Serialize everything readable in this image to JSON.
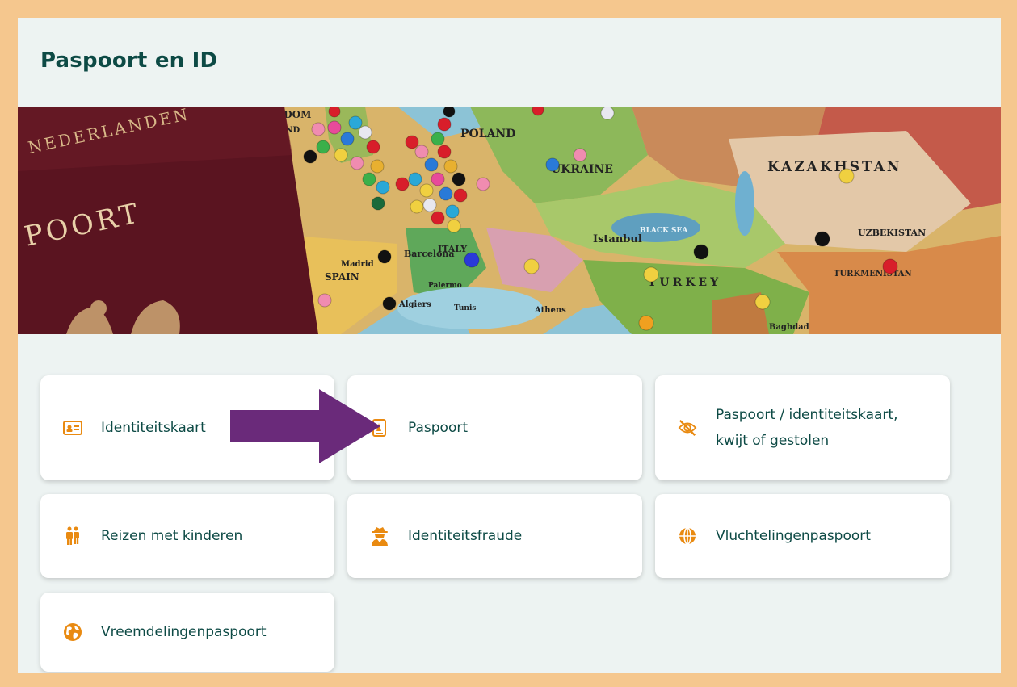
{
  "page": {
    "title": "Paspoort en ID"
  },
  "hero": {
    "passport_text_top": "NEDERLANDEN",
    "passport_text_bottom": "POORT",
    "map_labels": [
      "KINGDOM",
      "IRELAND",
      "POLAND",
      "UKRAINE",
      "KAZAKHSTAN",
      "SPAIN",
      "ITALY",
      "TURKEY",
      "Madrid",
      "Barcelona",
      "Istanbul",
      "Algiers",
      "Athens",
      "Tunis",
      "Palermo",
      "UZBEKISTAN",
      "TURKMENISTAN",
      "Baghdad",
      "BLACK SEA"
    ]
  },
  "tiles": [
    {
      "label": "Identiteitskaart",
      "icon": "id-card-icon"
    },
    {
      "label": "Paspoort",
      "icon": "passport-icon"
    },
    {
      "label_line1": "Paspoort / identiteitskaart,",
      "label_line2": "kwijt of gestolen",
      "icon": "eye-slash-icon"
    },
    {
      "label": "Reizen met kinderen",
      "icon": "child-icon"
    },
    {
      "label": "Identiteitsfraude",
      "icon": "user-secret-icon"
    },
    {
      "label": "Vluchtelingenpaspoort",
      "icon": "globe-icon"
    },
    {
      "label": "Vreemdelingenpaspoort",
      "icon": "earth-icon"
    }
  ],
  "colors": {
    "frame": "#f5c78e",
    "panel_bg": "#edf3f2",
    "title": "#0d4a45",
    "icon": "#e98a11",
    "arrow": "#6a2a7a"
  }
}
